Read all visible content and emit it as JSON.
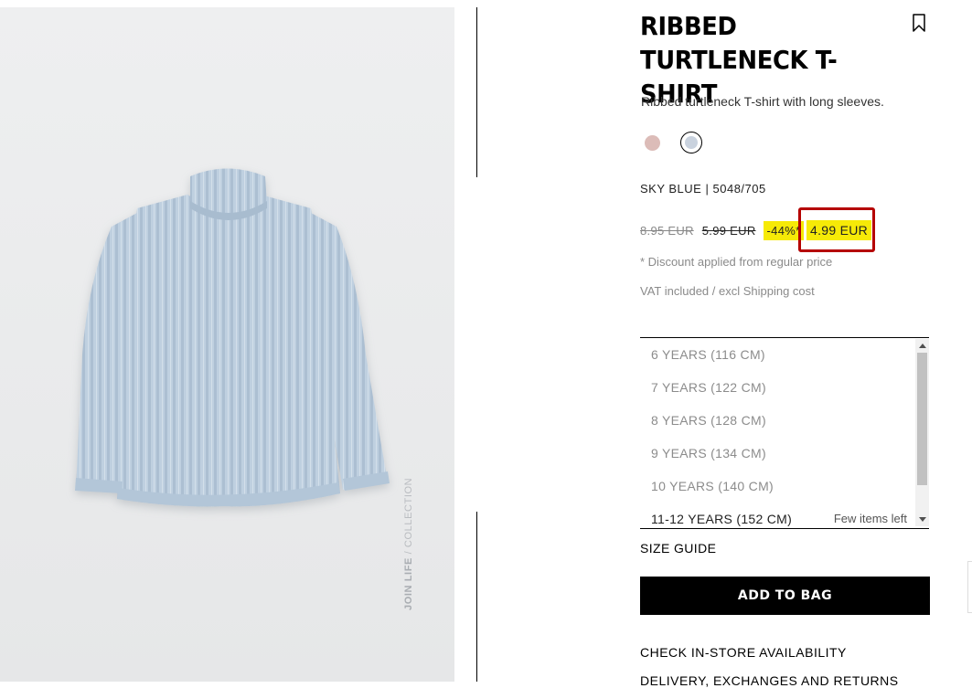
{
  "product": {
    "title": "RIBBED TURTLENECK T-SHIRT",
    "description": "Ribbed turtleneck T-shirt with long sleeves.",
    "color_name": "SKY BLUE",
    "separator": "|",
    "reference": "5048/705",
    "swatches": [
      {
        "name": "pink",
        "color": "#dcbcb8"
      },
      {
        "name": "sky blue",
        "color": "#c9d2de",
        "selected": true
      }
    ]
  },
  "image": {
    "watermark_strong": "JOIN LIFE",
    "watermark_rest": "/ COLLECTION"
  },
  "price": {
    "original": "8.95 EUR",
    "previous": "5.99 EUR",
    "discount": "-44%*",
    "final": "4.99 EUR",
    "discount_note": "* Discount applied from regular price",
    "vat_note": "VAT included / excl Shipping cost"
  },
  "sizes": [
    {
      "label": "6 YEARS (116 CM)",
      "available": false
    },
    {
      "label": "7 YEARS (122 CM)",
      "available": false
    },
    {
      "label": "8 YEARS (128 CM)",
      "available": false
    },
    {
      "label": "9 YEARS (134 CM)",
      "available": false
    },
    {
      "label": "10 YEARS (140 CM)",
      "available": false
    },
    {
      "label": "11-12 YEARS (152 CM)",
      "available": true,
      "note": "Few items left"
    }
  ],
  "actions": {
    "size_guide": "SIZE GUIDE",
    "add_to_bag": "ADD TO BAG",
    "check_store": "CHECK IN-STORE AVAILABILITY",
    "delivery": "DELIVERY, EXCHANGES AND RETURNS"
  },
  "colors": {
    "highlight": "#f6ea07",
    "annotation_box": "#b50000",
    "button": "#000000"
  }
}
